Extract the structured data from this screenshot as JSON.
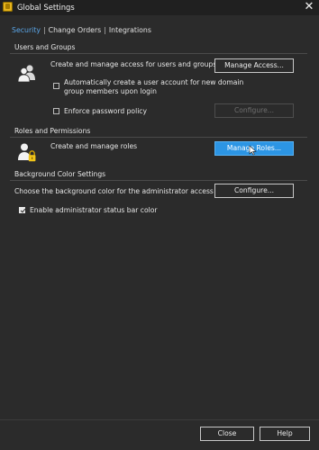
{
  "window": {
    "title": "Global Settings",
    "close_glyph": "✕"
  },
  "tabs": [
    {
      "label": "Security",
      "active": true
    },
    {
      "label": "Change Orders",
      "active": false
    },
    {
      "label": "Integrations",
      "active": false
    }
  ],
  "tab_separator": "|",
  "users_groups": {
    "title": "Users and Groups",
    "description": "Create and manage access for users and groups",
    "manage_button": "Manage Access...",
    "auto_create_label": "Automatically create a user account for new domain group members upon login",
    "auto_create_checked": false,
    "password_policy_label": "Enforce password policy",
    "password_policy_checked": false,
    "configure_button": "Configure...",
    "icon": "users-group-icon"
  },
  "roles": {
    "title": "Roles and Permissions",
    "description": "Create and manage roles",
    "manage_button": "Manage Roles...",
    "icon": "user-lock-icon"
  },
  "background": {
    "title": "Background Color Settings",
    "description": "Choose the background color for the administrator access",
    "configure_button": "Configure...",
    "status_bar_label": "Enable administrator status bar color",
    "status_bar_checked": true
  },
  "footer": {
    "close_button": "Close",
    "help_button": "Help"
  },
  "colors": {
    "background": "#2b2b2b",
    "titlebar": "#202020",
    "accent": "#2c95e4",
    "active_tab": "#5aa6e8",
    "app_icon": "#e7b51d"
  }
}
